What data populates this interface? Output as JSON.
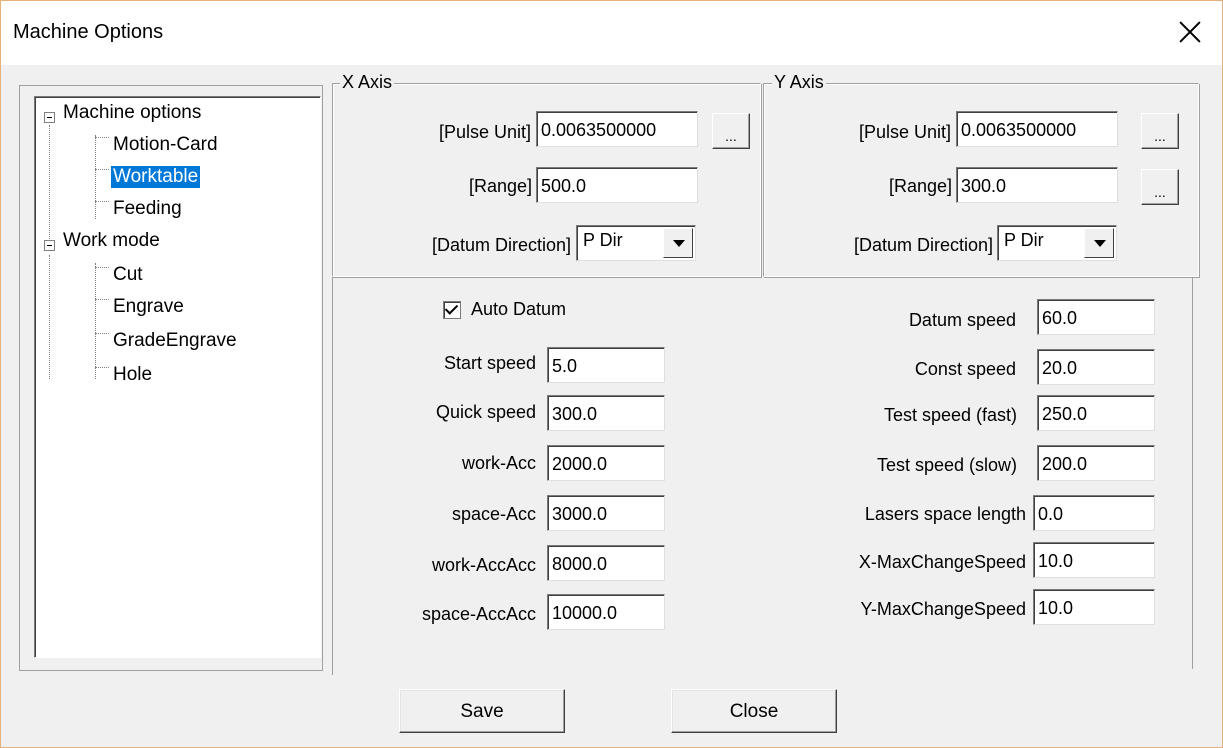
{
  "window": {
    "title": "Machine Options"
  },
  "tree": {
    "items": [
      {
        "label": "Machine options"
      },
      {
        "label": "Motion-Card"
      },
      {
        "label": "Worktable"
      },
      {
        "label": "Feeding"
      },
      {
        "label": "Work mode"
      },
      {
        "label": "Cut"
      },
      {
        "label": "Engrave"
      },
      {
        "label": "GradeEngrave"
      },
      {
        "label": "Hole"
      }
    ],
    "selected": "Worktable"
  },
  "x_axis": {
    "title": "X Axis",
    "pulse_unit_label": "[Pulse Unit]",
    "pulse_unit_value": "0.0063500000",
    "range_label": "[Range]",
    "range_value": "500.0",
    "datum_direction_label": "[Datum Direction]",
    "datum_direction_value": "P Dir",
    "browse_label": "..."
  },
  "y_axis": {
    "title": "Y Axis",
    "pulse_unit_label": "[Pulse Unit]",
    "pulse_unit_value": "0.0063500000",
    "range_label": "[Range]",
    "range_value": "300.0",
    "datum_direction_label": "[Datum Direction]",
    "datum_direction_value": "P Dir",
    "browse_label": "..."
  },
  "params": {
    "auto_datum_label": "Auto Datum",
    "auto_datum_checked": true,
    "left": [
      {
        "label": "Start speed",
        "value": "5.0"
      },
      {
        "label": "Quick speed",
        "value": "300.0"
      },
      {
        "label": "work-Acc",
        "value": "2000.0"
      },
      {
        "label": "space-Acc",
        "value": "3000.0"
      },
      {
        "label": "work-AccAcc",
        "value": "8000.0"
      },
      {
        "label": "space-AccAcc",
        "value": "10000.0"
      }
    ],
    "right": [
      {
        "label": "Datum speed",
        "value": "60.0"
      },
      {
        "label": "Const speed",
        "value": "20.0"
      },
      {
        "label": "Test speed (fast)",
        "value": "250.0"
      },
      {
        "label": "Test speed (slow)",
        "value": "200.0"
      },
      {
        "label": "Lasers space length",
        "value": "0.0"
      },
      {
        "label": "X-MaxChangeSpeed",
        "value": "10.0"
      },
      {
        "label": "Y-MaxChangeSpeed",
        "value": "10.0"
      }
    ]
  },
  "buttons": {
    "save": "Save",
    "close": "Close"
  }
}
